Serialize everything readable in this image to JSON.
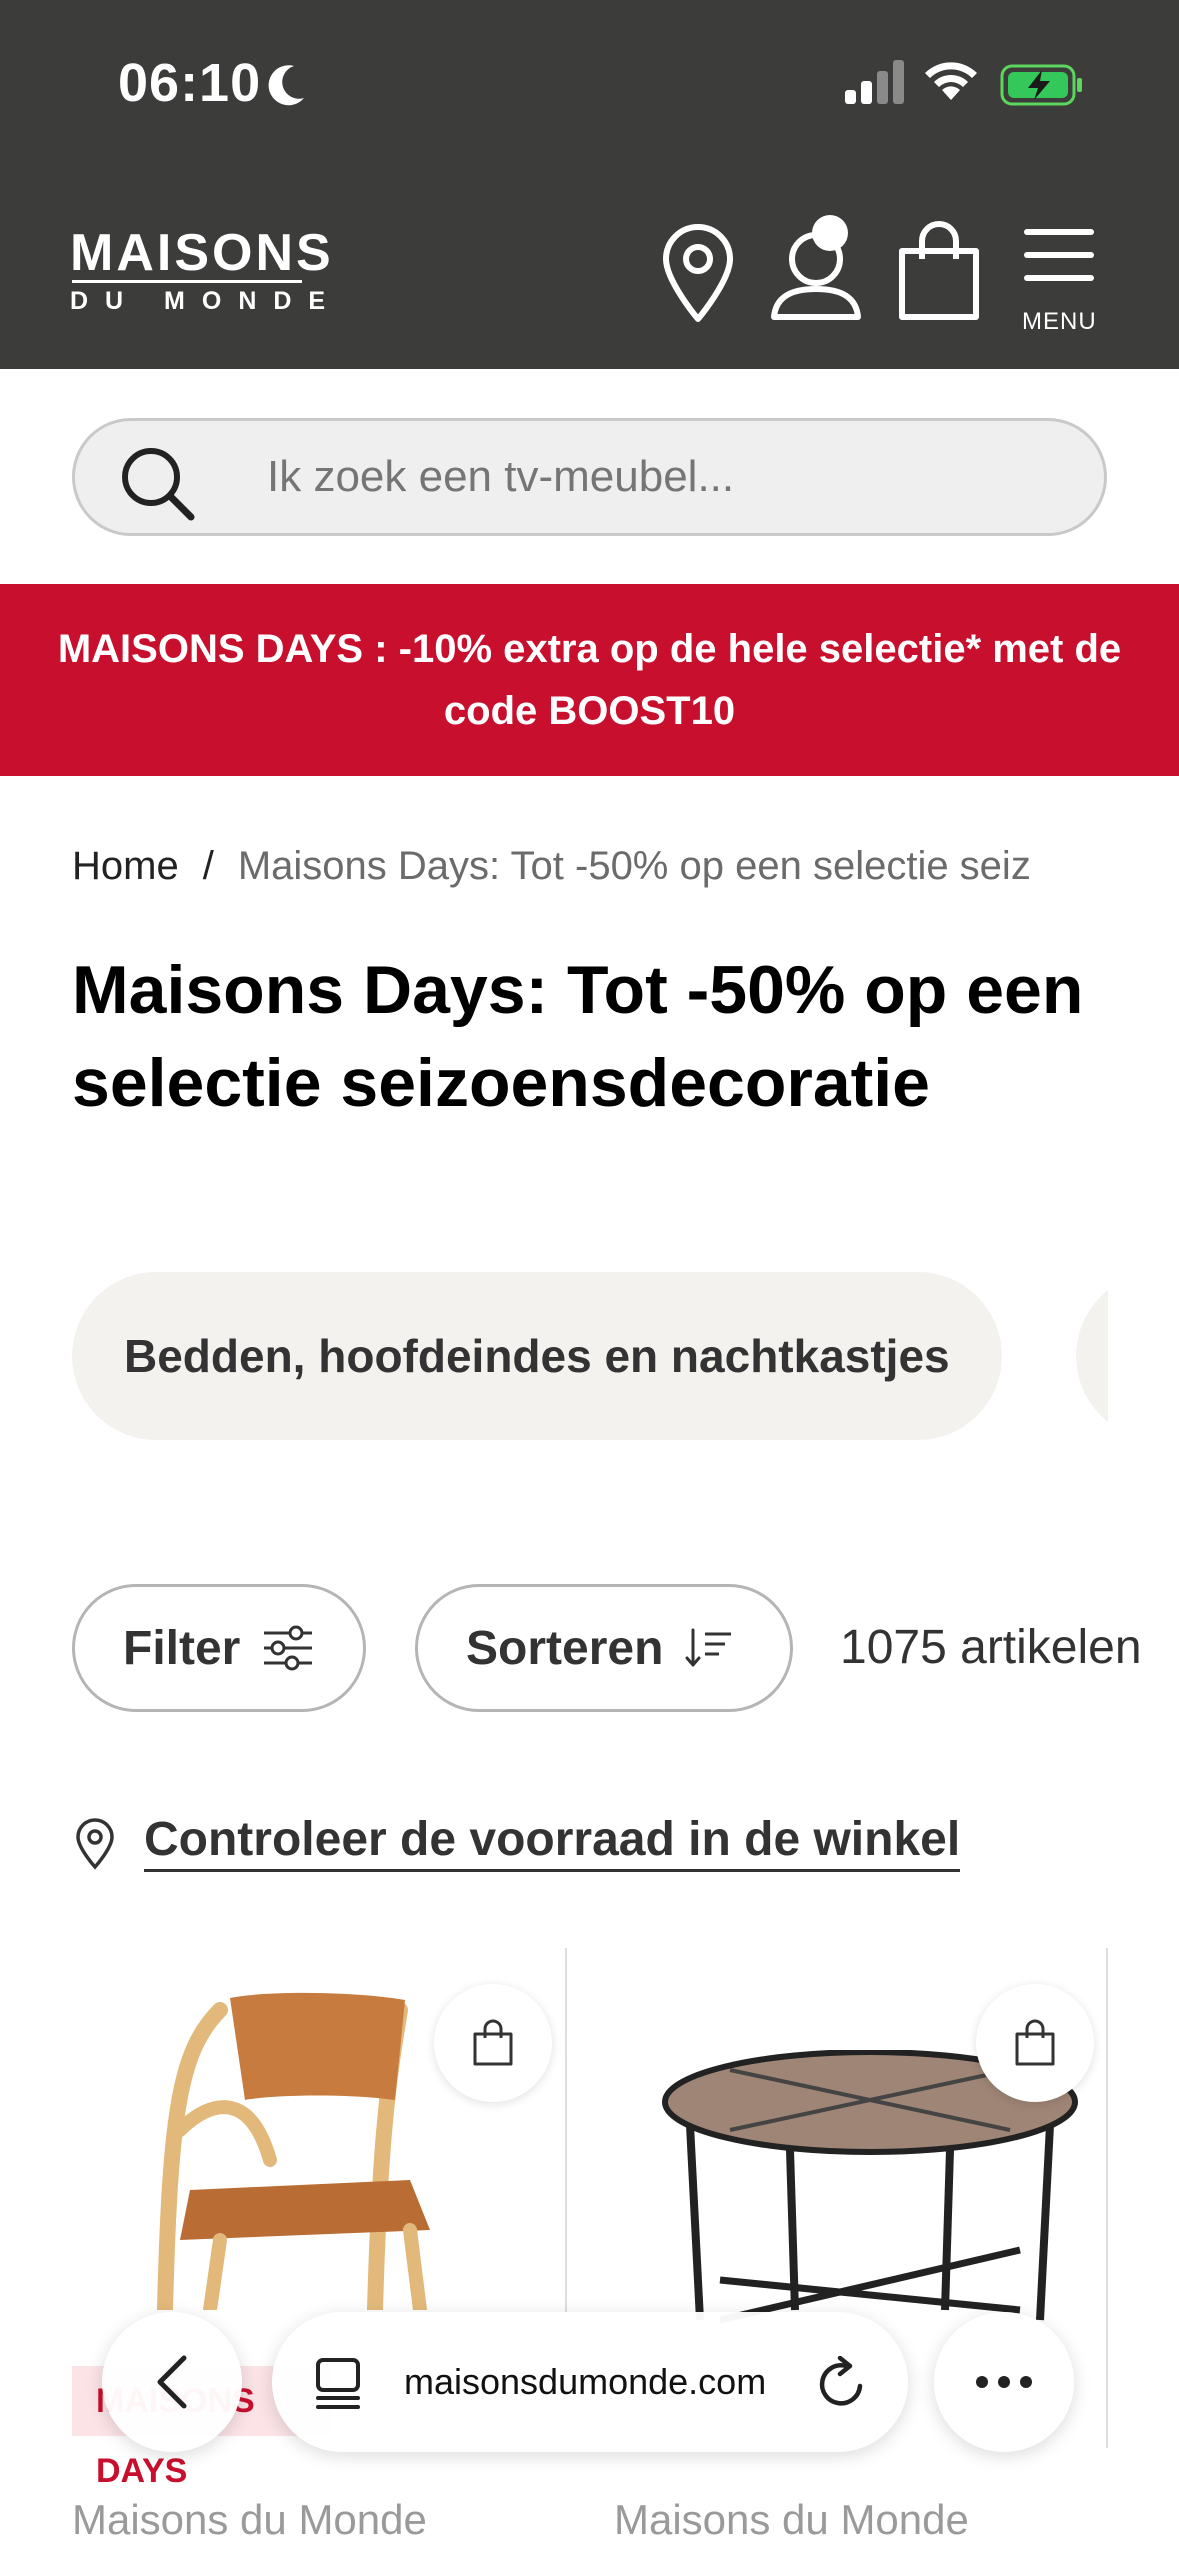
{
  "status_bar": {
    "time": "06:10"
  },
  "header": {
    "logo_top": "MAISONS",
    "logo_bottom": "DU MONDE",
    "menu_label": "MENU"
  },
  "search": {
    "placeholder": "Ik zoek een tv-meubel..."
  },
  "promo": {
    "text": "MAISONS DAYS : -10% extra op de hele selectie* met de code BOOST10"
  },
  "breadcrumb": {
    "home": "Home",
    "separator": "/",
    "current": "Maisons Days: Tot -50% op een selectie seiz"
  },
  "page_title": "Maisons Days: Tot -50% op een selectie seizoensdecoratie",
  "categories": [
    {
      "label": "Bedden, hoofdeindes en nachtkastjes"
    }
  ],
  "toolbar": {
    "filter_label": "Filter",
    "sort_label": "Sorteren",
    "count": "1075 artikelen"
  },
  "stock_link": "Controleer de voorraad in de winkel",
  "products": [
    {
      "brand": "Maisons du Monde",
      "badge": "MAISONS DAYS"
    },
    {
      "brand": "Maisons du Monde"
    }
  ],
  "browser": {
    "url": "maisonsdumonde.com"
  },
  "colors": {
    "header_bg": "#3c3c3b",
    "promo_bg": "#c8102e",
    "chip_bg": "#f4f2ee"
  }
}
